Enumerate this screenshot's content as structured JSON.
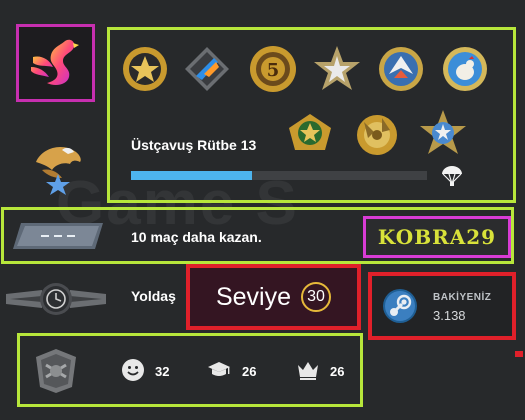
{
  "watermark": "Game S",
  "profile": {
    "rank_title": "Üstçavuş Rütbe 13",
    "xp_progress": 0.41,
    "win_message": "10 maç daha kazan.",
    "name": "KOBRA29",
    "commendation_title": "Yoldaş",
    "level_label": "Seviye",
    "level_value": "30"
  },
  "wallet": {
    "label": "BAKİYENİZ",
    "value": "3.138"
  },
  "stats": {
    "friendly": "32",
    "teacher": "26",
    "leader": "26"
  },
  "colors": {
    "highlight_green": "#b7e63b",
    "highlight_red": "#e0202a",
    "highlight_magenta": "#d93cd6",
    "name_yellow": "#d9e23a",
    "xp_blue": "#4db4ee"
  },
  "icons": [
    "flamingo-avatar-icon",
    "eagle-rank-icon",
    "medal-icon",
    "parachute-icon",
    "wingman-rank-icon",
    "service-medal-icon",
    "steam-icon",
    "coin-icon",
    "smiley-icon",
    "graduation-cap-icon",
    "crown-icon"
  ]
}
